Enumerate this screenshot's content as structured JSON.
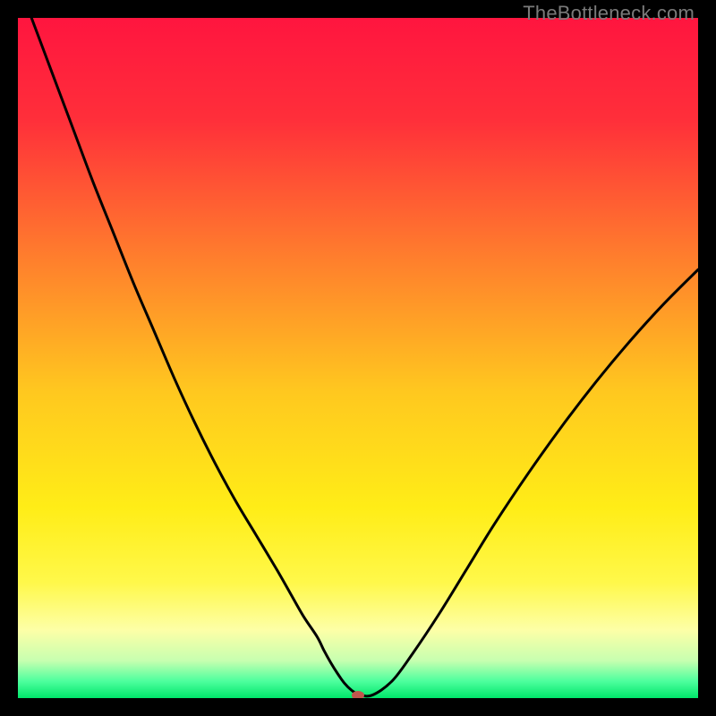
{
  "watermark": "TheBottleneck.com",
  "chart_data": {
    "type": "line",
    "title": "",
    "xlabel": "",
    "ylabel": "",
    "xlim": [
      0,
      100
    ],
    "ylim": [
      0,
      100
    ],
    "grid": false,
    "legend": false,
    "background_gradient": {
      "stops": [
        {
          "offset": 0.0,
          "color": "#ff153f"
        },
        {
          "offset": 0.15,
          "color": "#ff2f3a"
        },
        {
          "offset": 0.35,
          "color": "#ff7d2d"
        },
        {
          "offset": 0.55,
          "color": "#ffc81f"
        },
        {
          "offset": 0.72,
          "color": "#ffed17"
        },
        {
          "offset": 0.83,
          "color": "#fff84a"
        },
        {
          "offset": 0.9,
          "color": "#fdffa7"
        },
        {
          "offset": 0.945,
          "color": "#c7ffb0"
        },
        {
          "offset": 0.975,
          "color": "#4eff9e"
        },
        {
          "offset": 1.0,
          "color": "#00e66a"
        }
      ]
    },
    "series": [
      {
        "name": "bottleneck-curve",
        "color": "#000000",
        "x": [
          2,
          5,
          8,
          11,
          14,
          17,
          20,
          23,
          26,
          29,
          32,
          35,
          38,
          40,
          42,
          44,
          45,
          46,
          47,
          48,
          49,
          50,
          52,
          55,
          58,
          62,
          66,
          70,
          75,
          80,
          85,
          90,
          95,
          100
        ],
        "y": [
          100,
          92,
          84,
          76,
          68.5,
          61,
          54,
          47,
          40.5,
          34.5,
          29,
          24,
          19,
          15.5,
          12,
          9,
          7,
          5.2,
          3.6,
          2.2,
          1.2,
          0.6,
          0.4,
          2.5,
          6.5,
          12.5,
          19,
          25.5,
          33,
          40,
          46.5,
          52.5,
          58,
          63
        ]
      }
    ],
    "marker": {
      "name": "min-bottleneck-marker",
      "x": 50,
      "y": 0.4,
      "color": "#c0564d",
      "rx": 7,
      "ry": 5
    }
  }
}
